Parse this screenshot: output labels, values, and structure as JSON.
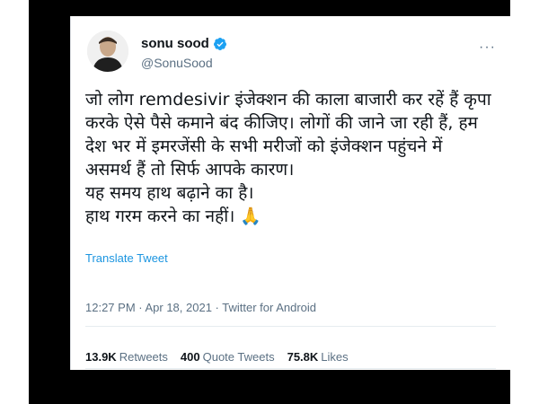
{
  "colors": {
    "frame": "#000000",
    "link": "#1b95e0",
    "verified": "#1da1f2",
    "muted": "#5b7083",
    "text": "#0f1419"
  },
  "user": {
    "name": "sonu sood",
    "handle": "@SonuSood",
    "verified": true
  },
  "more_icon": "···",
  "tweet": {
    "lines": [
      "जो लोग remdesivir इंजेक्शन की काला बाजारी कर रहें हैं कृपा",
      "करके ऐसे पैसे कमाने बंद कीजिए। लोगों की जाने जा रही हैं, हम",
      "देश भर में इमरजेंसी के सभी मरीजों को इंजेक्शन पहुंचने में",
      "असमर्थ हैं तो सिर्फ आपके कारण।",
      "यह समय हाथ बढ़ाने का है।",
      "हाथ गरम करने का नहीं। 🙏"
    ]
  },
  "translate_label": "Translate Tweet",
  "meta": "12:27 PM · Apr 18, 2021 · Twitter for Android",
  "stats": {
    "retweets_count": "13.9K",
    "retweets_label": "Retweets",
    "quotes_count": "400",
    "quotes_label": "Quote Tweets",
    "likes_count": "75.8K",
    "likes_label": "Likes"
  }
}
